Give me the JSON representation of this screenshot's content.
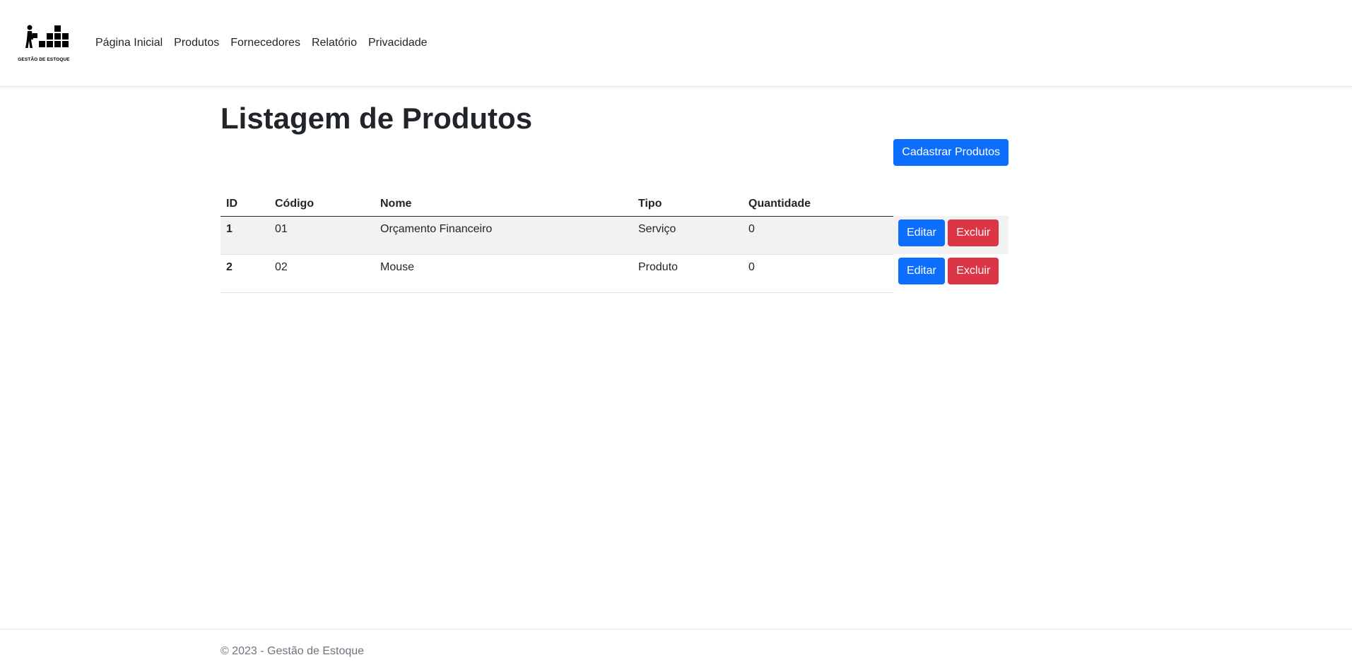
{
  "brand": {
    "logo_text": "GESTÃO DE ESTOQUE"
  },
  "nav": {
    "items": [
      {
        "label": "Página Inicial"
      },
      {
        "label": "Produtos"
      },
      {
        "label": "Fornecedores"
      },
      {
        "label": "Relatório"
      },
      {
        "label": "Privacidade"
      }
    ]
  },
  "main": {
    "title": "Listagem de Produtos",
    "create_button": "Cadastrar Produtos",
    "table": {
      "headers": [
        "ID",
        "Código",
        "Nome",
        "Tipo",
        "Quantidade"
      ],
      "rows": [
        {
          "id": "1",
          "codigo": "01",
          "nome": "Orçamento Financeiro",
          "tipo": "Serviço",
          "quantidade": "0"
        },
        {
          "id": "2",
          "codigo": "02",
          "nome": "Mouse",
          "tipo": "Produto",
          "quantidade": "0"
        }
      ],
      "edit_label": "Editar",
      "delete_label": "Excluir"
    }
  },
  "footer": {
    "text": "© 2023 - Gestão de Estoque"
  },
  "colors": {
    "primary": "#0d6efd",
    "danger": "#dc3545",
    "stripe": "#f2f2f2"
  }
}
